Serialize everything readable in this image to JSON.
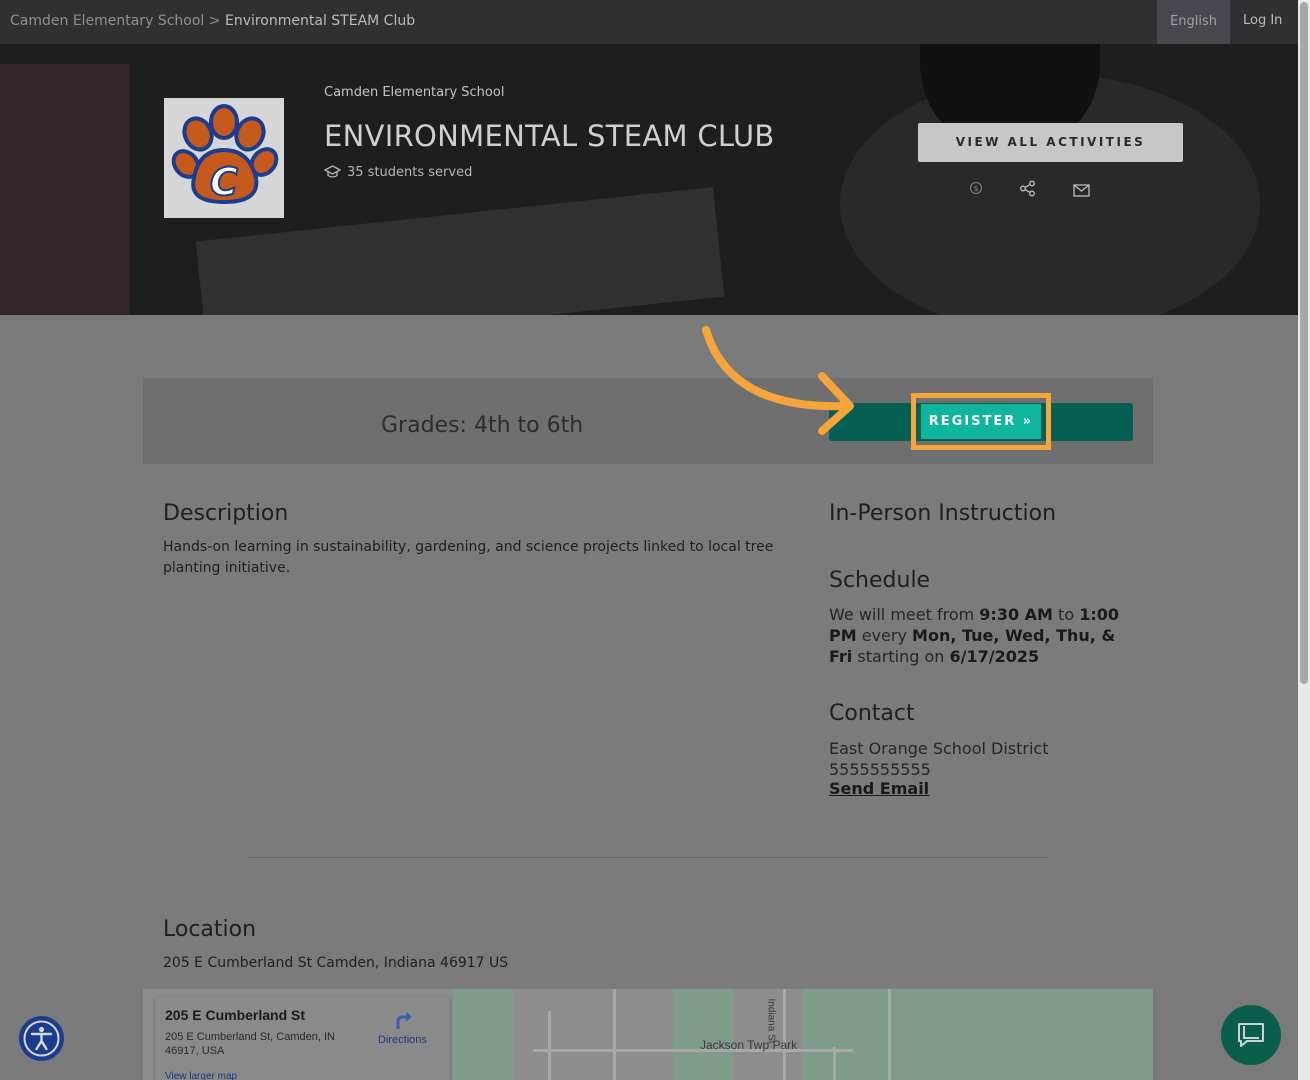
{
  "breadcrumb": {
    "parent": "Camden Elementary School",
    "separator": " > ",
    "current": "Environmental STEAM Club"
  },
  "topnav": {
    "language": "English",
    "login": "Log In"
  },
  "hero": {
    "school": "Camden Elementary School",
    "title": "ENVIRONMENTAL STEAM CLUB",
    "students_served": "35 students served",
    "view_all_label": "VIEW ALL ACTIVITIES",
    "icons": [
      "dollar-icon",
      "share-icon",
      "mail-icon"
    ]
  },
  "registration": {
    "grades": "Grades: 4th to 6th",
    "register_label": "REGISTER »"
  },
  "description": {
    "heading": "Description",
    "text": "Hands-on learning in sustainability, gardening, and science projects linked to local tree planting initiative."
  },
  "instruction": {
    "heading": "In-Person Instruction"
  },
  "schedule": {
    "heading": "Schedule",
    "prefix": "We will meet from ",
    "start_time": "9:30 AM",
    "to": " to ",
    "end_time": "1:00 PM",
    "every": " every ",
    "days": "Mon, Tue, Wed, Thu, & Fri",
    "starting": " starting on ",
    "start_date": "6/17/2025"
  },
  "contact": {
    "heading": "Contact",
    "org": "East Orange School District",
    "phone": "5555555555",
    "email_link": "Send Email"
  },
  "location": {
    "heading": "Location",
    "address": "205 E Cumberland St Camden, Indiana 46917 US"
  },
  "map": {
    "place_title": "205 E Cumberland St",
    "place_address": "205 E Cumberland St, Camden, IN 46917, USA",
    "directions": "Directions",
    "larger_map": "View larger map",
    "park_label": "Jackson Twp Park",
    "street_label": "Indiana St"
  },
  "colors": {
    "topbar": "#2e3134",
    "register_bar": "#075e52",
    "register_button": "#0fb59c",
    "highlight": "#f6a53b",
    "chat_button": "#0b5e4c",
    "accessibility_button": "#1c3d8f"
  }
}
